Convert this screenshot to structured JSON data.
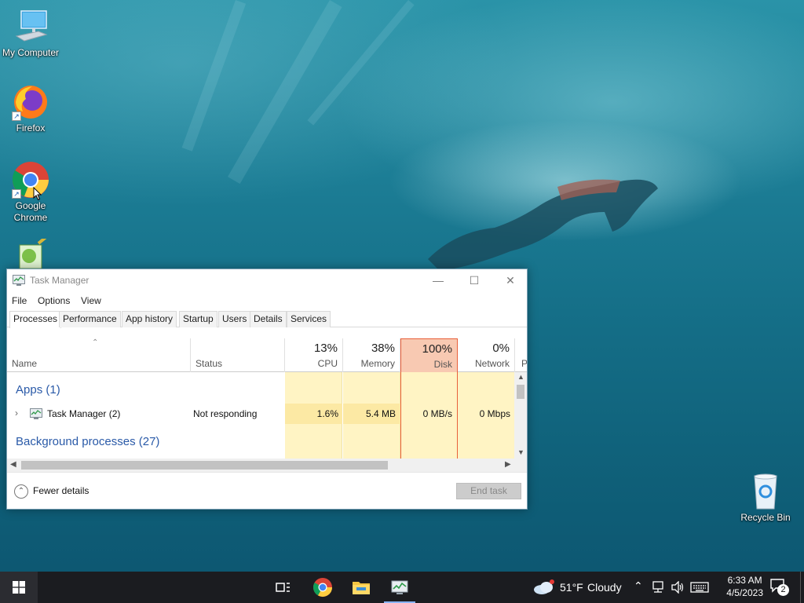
{
  "desktop": {
    "icons": [
      {
        "name": "my-computer",
        "label": "My Computer"
      },
      {
        "name": "firefox",
        "label": "Firefox"
      },
      {
        "name": "google-chrome",
        "label": "Google Chrome"
      },
      {
        "name": "notepad-plus-plus",
        "label": ""
      },
      {
        "name": "recycle-bin",
        "label": "Recycle Bin"
      }
    ]
  },
  "task_manager": {
    "title": "Task Manager",
    "menu": [
      "File",
      "Options",
      "View"
    ],
    "tabs": [
      "Processes",
      "Performance",
      "App history",
      "Startup",
      "Users",
      "Details",
      "Services"
    ],
    "active_tab": "Processes",
    "columns": {
      "name": "Name",
      "status": "Status",
      "cpu": {
        "pct": "13%",
        "label": "CPU"
      },
      "memory": {
        "pct": "38%",
        "label": "Memory"
      },
      "disk": {
        "pct": "100%",
        "label": "Disk"
      },
      "network": {
        "pct": "0%",
        "label": "Network"
      },
      "power_partial": "P"
    },
    "groups": {
      "apps": "Apps (1)",
      "background": "Background processes (27)"
    },
    "rows": [
      {
        "name": "Task Manager (2)",
        "status": "Not responding",
        "cpu": "1.6%",
        "memory": "5.4 MB",
        "disk": "0 MB/s",
        "network": "0 Mbps"
      }
    ],
    "footer": {
      "fewer_details": "Fewer details",
      "end_task": "End task"
    },
    "colors": {
      "disk_header": "#f8c9b2",
      "usage_cell": "#fff4c4",
      "usage_cell_strong": "#fce9a4",
      "disk_border": "#e8603b"
    }
  },
  "taskbar": {
    "weather": {
      "temp": "51°F",
      "condition": "Cloudy"
    },
    "clock": {
      "time": "6:33 AM",
      "date": "4/5/2023"
    },
    "notification_count": "2"
  }
}
